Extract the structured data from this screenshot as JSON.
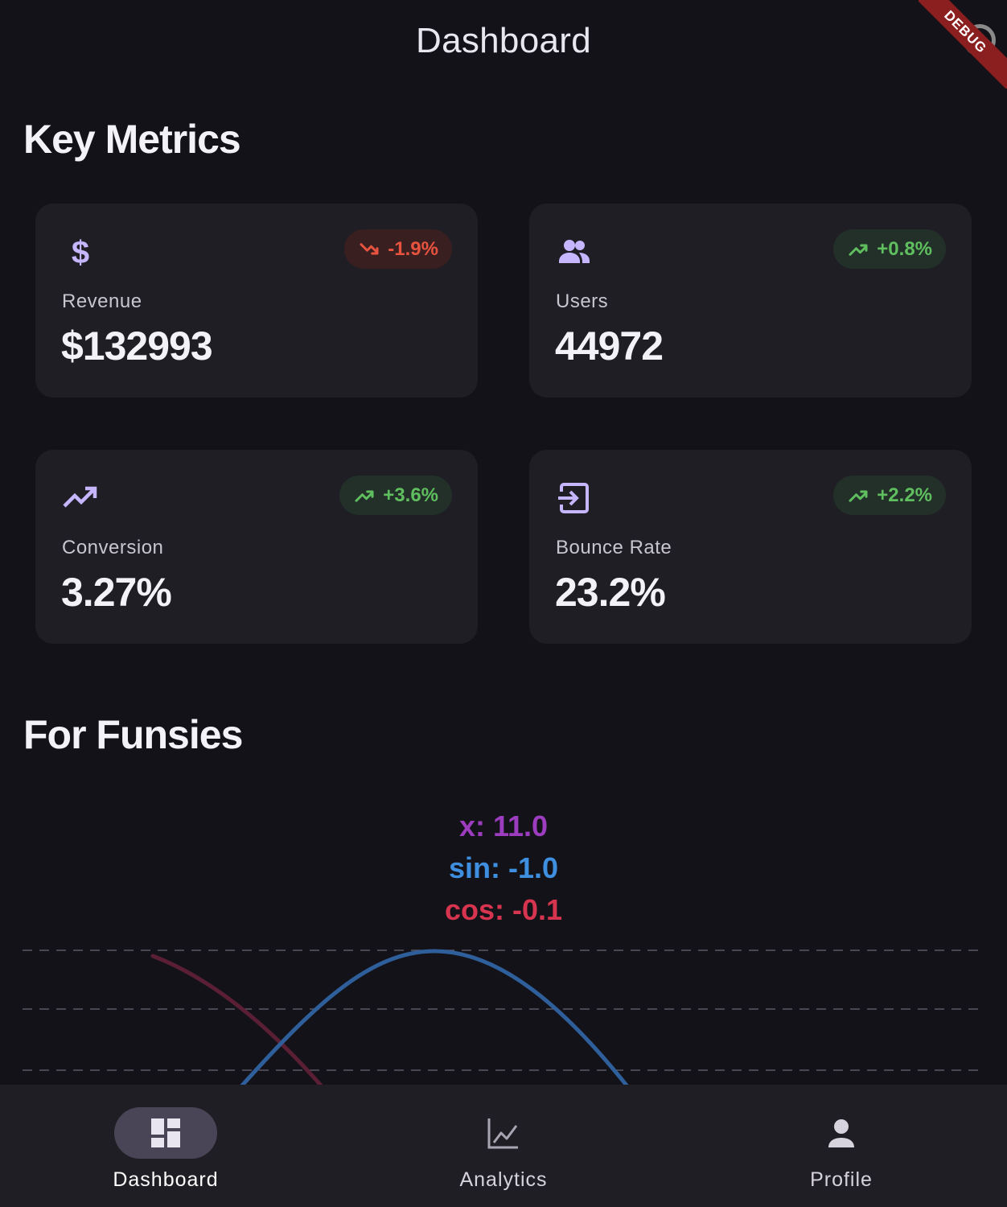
{
  "appbar": {
    "title": "Dashboard",
    "debug_banner": "DEBUG"
  },
  "sections": {
    "key_metrics": "Key Metrics",
    "for_funsies": "For Funsies"
  },
  "metrics": [
    {
      "label": "Revenue",
      "value": "$132993",
      "change": "-1.9%",
      "trend": "down",
      "icon": "dollar-icon"
    },
    {
      "label": "Users",
      "value": "44972",
      "change": "+0.8%",
      "trend": "up",
      "icon": "people-icon"
    },
    {
      "label": "Conversion",
      "value": "3.27%",
      "change": "+3.6%",
      "trend": "up",
      "icon": "trending-up-icon"
    },
    {
      "label": "Bounce Rate",
      "value": "23.2%",
      "change": "+2.2%",
      "trend": "up",
      "icon": "login-icon"
    }
  ],
  "chart_readout": {
    "x": "x: 11.0",
    "sin": "sin: -1.0",
    "cos": "cos: -0.1"
  },
  "chart_data": {
    "type": "line",
    "series": [
      {
        "name": "sin",
        "color": "#2f5f9a"
      },
      {
        "name": "cos",
        "color": "#5a1f35"
      }
    ],
    "grid": "dashed horizontal"
  },
  "nav": {
    "items": [
      {
        "label": "Dashboard",
        "icon": "dashboard-icon",
        "active": true
      },
      {
        "label": "Analytics",
        "icon": "analytics-icon",
        "active": false
      },
      {
        "label": "Profile",
        "icon": "person-icon",
        "active": false
      }
    ]
  },
  "colors": {
    "accent": "#c6b6ff",
    "positive": "#5fbf5f",
    "negative": "#e8533f",
    "background": "#131218",
    "card": "#1f1e24"
  }
}
